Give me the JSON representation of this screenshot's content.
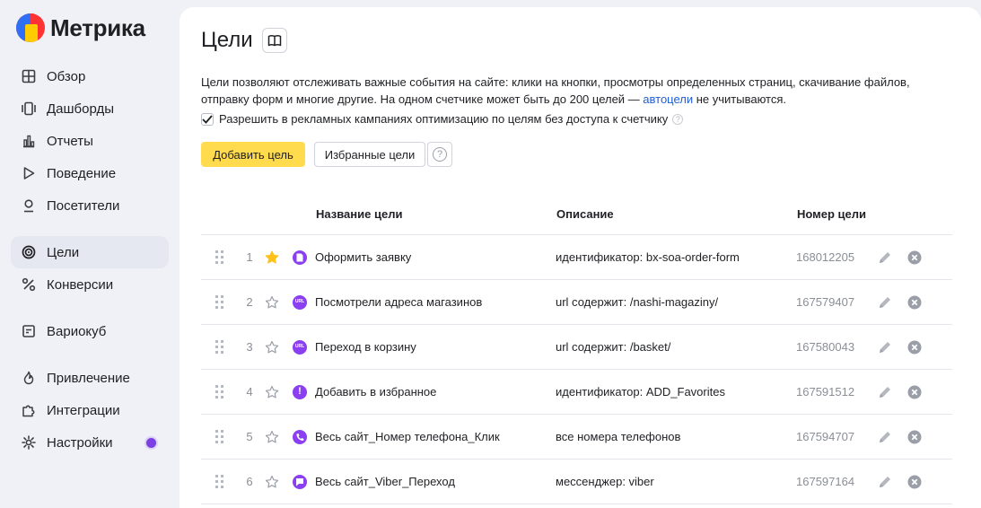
{
  "app": {
    "name": "Метрика"
  },
  "sidebar": {
    "items": [
      {
        "label": "Обзор",
        "icon": "grid-icon"
      },
      {
        "label": "Дашборды",
        "icon": "dashboard-icon"
      },
      {
        "label": "Отчеты",
        "icon": "bar-chart-icon"
      },
      {
        "label": "Поведение",
        "icon": "play-icon"
      },
      {
        "label": "Посетители",
        "icon": "person-icon"
      },
      {
        "label": "Цели",
        "icon": "target-icon",
        "active": true
      },
      {
        "label": "Конверсии",
        "icon": "percent-icon"
      },
      {
        "label": "Вариокуб",
        "icon": "cube-icon"
      },
      {
        "label": "Привлечение",
        "icon": "flame-icon"
      },
      {
        "label": "Интеграции",
        "icon": "puzzle-icon"
      },
      {
        "label": "Настройки",
        "icon": "gear-icon",
        "badge": "purple-dot"
      }
    ]
  },
  "page": {
    "title": "Цели",
    "description_main": "Цели позволяют отслеживать важные события на сайте: клики на кнопки, просмотры определенных страниц, скачивание файлов, отправку форм и многие другие. На одном счетчике может быть до 200 целей — ",
    "description_link": "автоцели",
    "description_tail": " не учитываются.",
    "checkbox_label": "Разрешить в рекламных кампаниях оптимизацию по целям без доступа к счетчику",
    "checkbox_checked": true,
    "add_button": "Добавить цель",
    "favorites_button": "Избранные цели",
    "help_button": "?"
  },
  "table": {
    "headers": {
      "name": "Название цели",
      "description": "Описание",
      "id": "Номер цели"
    },
    "rows": [
      {
        "num": "1",
        "starred": true,
        "type_icon": "form-icon",
        "name": "Оформить заявку",
        "description": "идентификатор: bx-soa-order-form",
        "id": "168012205"
      },
      {
        "num": "2",
        "starred": false,
        "type_icon": "url-icon",
        "name": "Посмотрели адреса магазинов",
        "description": "url содержит: /nashi-magaziny/",
        "id": "167579407"
      },
      {
        "num": "3",
        "starred": false,
        "type_icon": "url-icon",
        "name": "Переход в корзину",
        "description": "url содержит: /basket/",
        "id": "167580043"
      },
      {
        "num": "4",
        "starred": false,
        "type_icon": "exclamation-icon",
        "name": "Добавить в избранное",
        "description": "идентификатор: ADD_Favorites",
        "id": "167591512"
      },
      {
        "num": "5",
        "starred": false,
        "type_icon": "phone-icon",
        "name": "Весь сайт_Номер телефона_Клик",
        "description": "все номера телефонов",
        "id": "167594707"
      },
      {
        "num": "6",
        "starred": false,
        "type_icon": "messenger-icon",
        "name": "Весь сайт_Viber_Переход",
        "description": "мессенджер: viber",
        "id": "167597164"
      }
    ]
  },
  "colors": {
    "accent": "#ffdb4d",
    "type_icon": "#8a3ff0",
    "star_active": "#ffc21a",
    "link": "#1e5fd6"
  }
}
